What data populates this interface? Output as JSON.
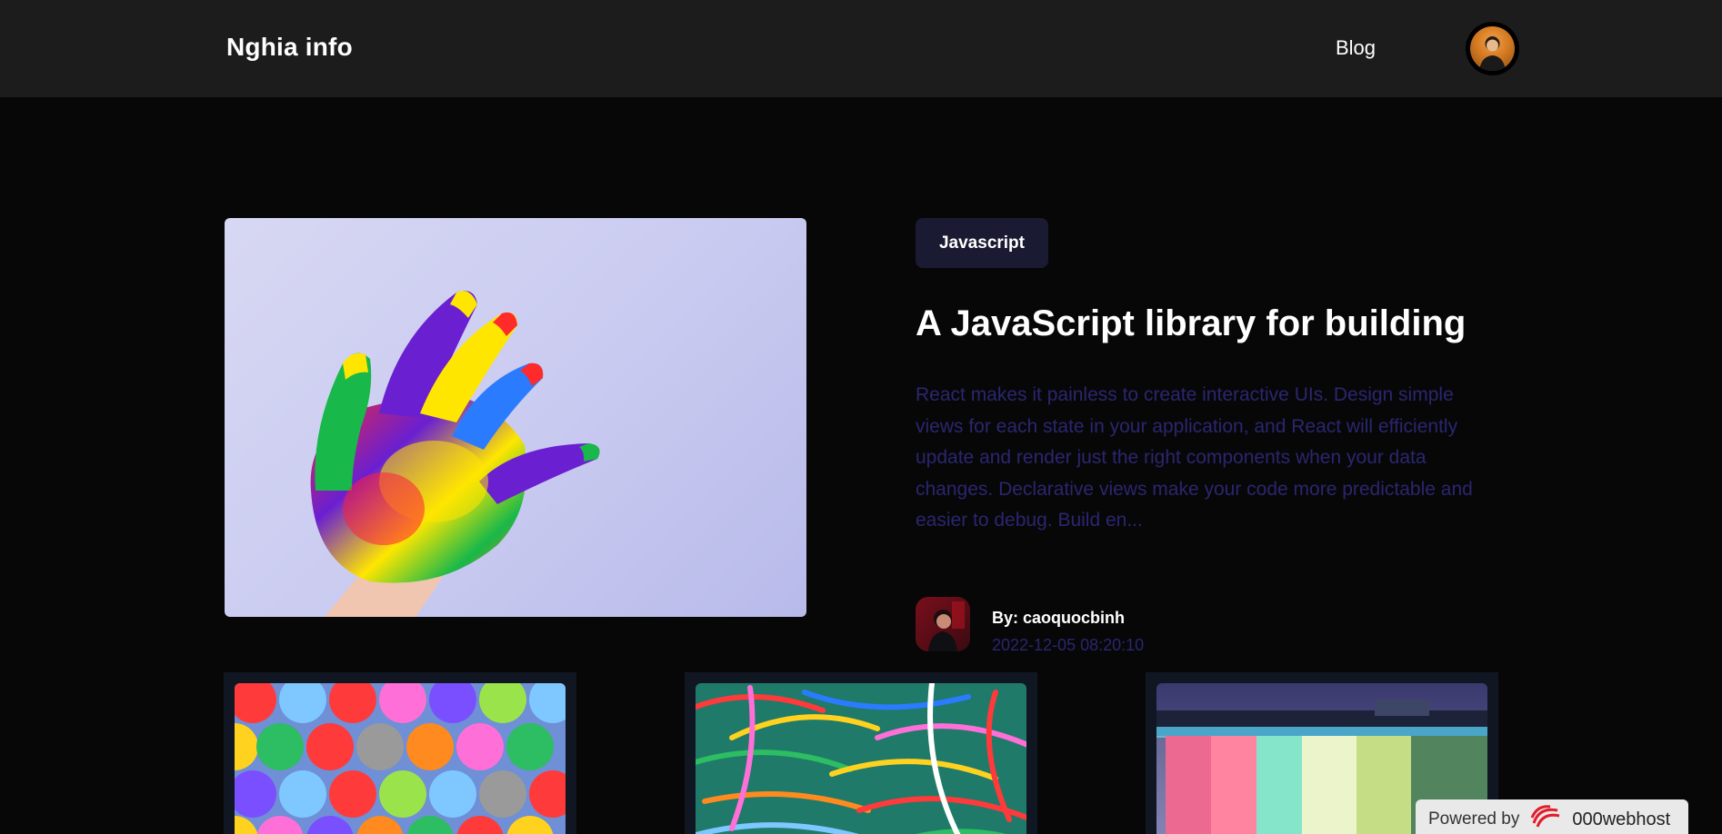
{
  "header": {
    "logo": "Nghia info",
    "nav": {
      "blog": "Blog"
    }
  },
  "featured": {
    "tag": "Javascript",
    "title": "A JavaScript library for building",
    "excerpt": "React makes it painless to create interactive UIs. Design simple views for each state in your application, and React will efficiently update and render just the right components when your data changes. Declarative views make your code more predictable and easier to debug. Build en...",
    "author": "By: caoquocbinh",
    "date": "2022-12-05 08:20:10"
  },
  "footer_badge": {
    "prefix": "Powered by",
    "brand": "000webhost"
  },
  "colors": {
    "header_bg": "#1c1c1c",
    "page_bg": "#070707",
    "tag_bg": "#1a1b33",
    "muted_text": "#2a2670",
    "card_bg": "#111722"
  }
}
